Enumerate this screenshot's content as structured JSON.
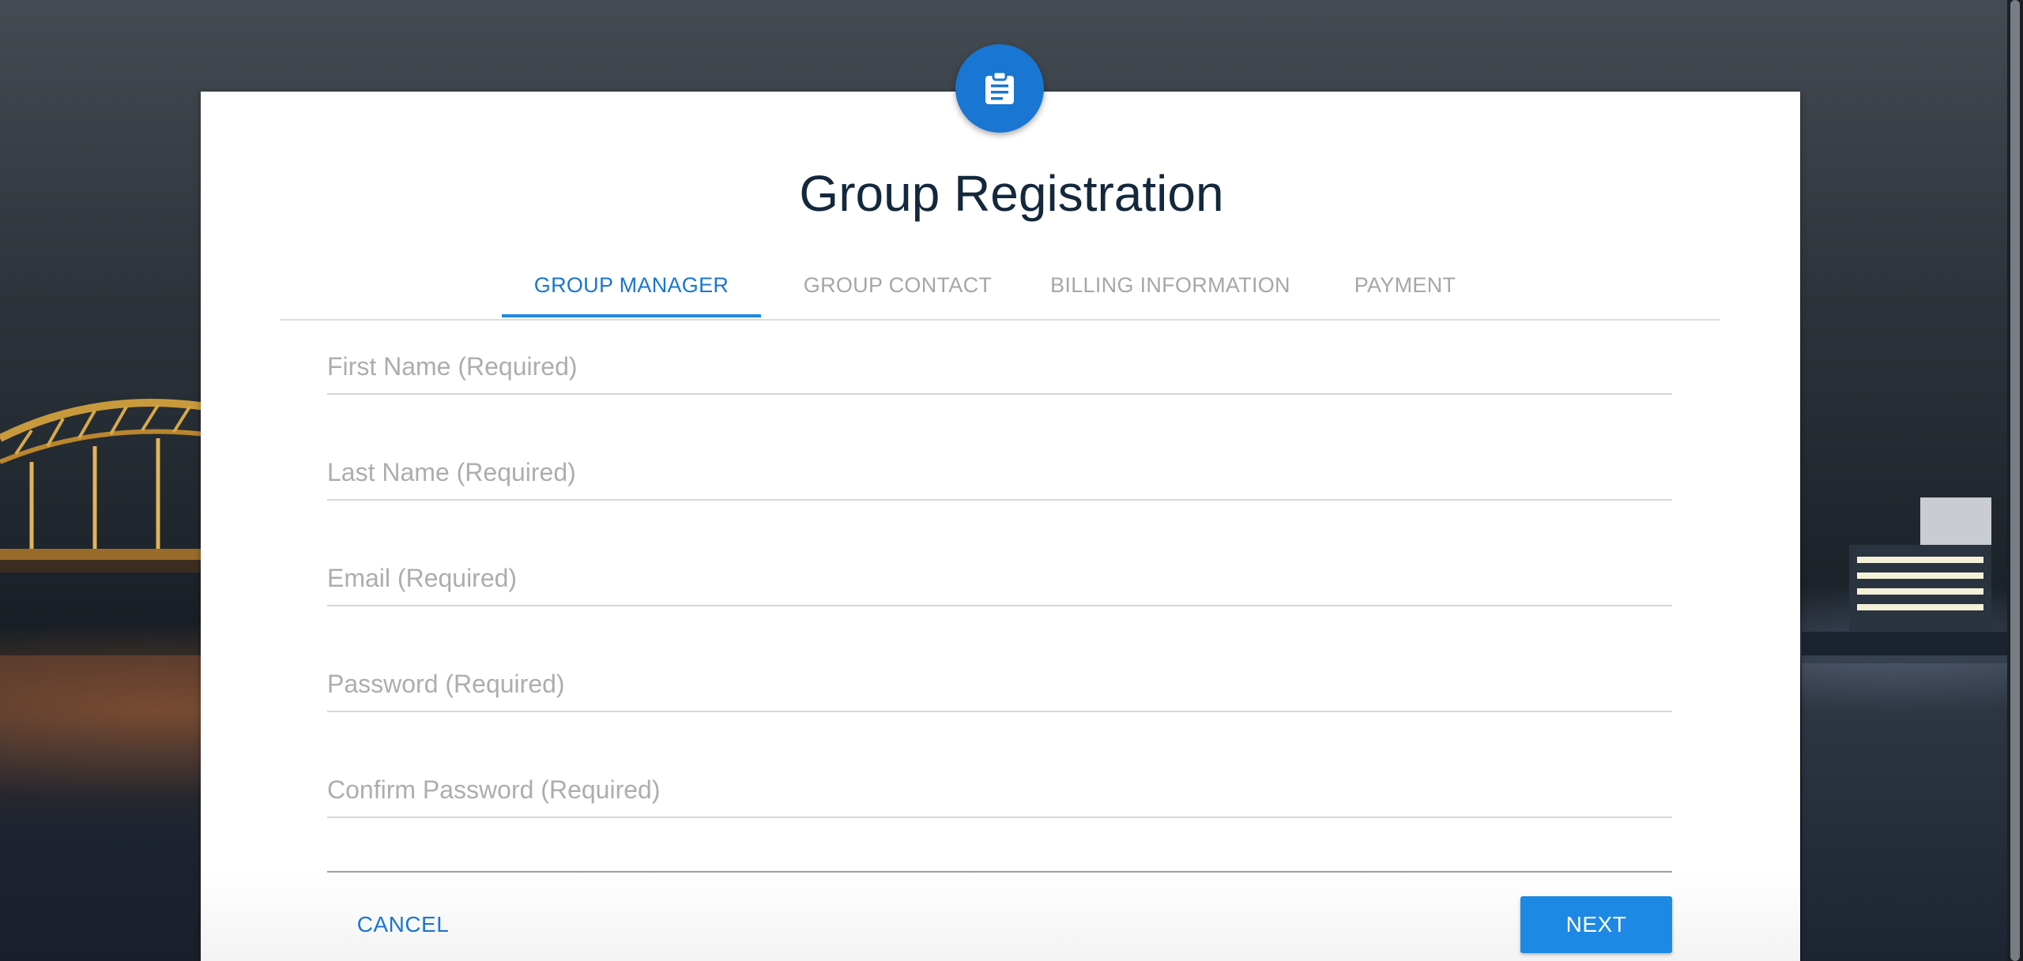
{
  "page": {
    "title": "Group Registration"
  },
  "header_icon": "clipboard-icon",
  "tabs": [
    {
      "label": "GROUP MANAGER",
      "active": true
    },
    {
      "label": "GROUP CONTACT",
      "active": false
    },
    {
      "label": "BILLING INFORMATION",
      "active": false
    },
    {
      "label": "PAYMENT",
      "active": false
    }
  ],
  "form": {
    "first_name": {
      "placeholder": "First Name (Required)",
      "value": ""
    },
    "last_name": {
      "placeholder": "Last Name (Required)",
      "value": ""
    },
    "email": {
      "placeholder": "Email (Required)",
      "value": ""
    },
    "password": {
      "placeholder": "Password (Required)",
      "value": ""
    },
    "confirm_password": {
      "placeholder": "Confirm Password (Required)",
      "value": ""
    }
  },
  "actions": {
    "cancel_label": "CANCEL",
    "next_label": "NEXT"
  },
  "colors": {
    "accent": "#1976d2",
    "button": "#1e88e5",
    "title": "#14283c",
    "inactive_tab": "#a6a6a6"
  }
}
